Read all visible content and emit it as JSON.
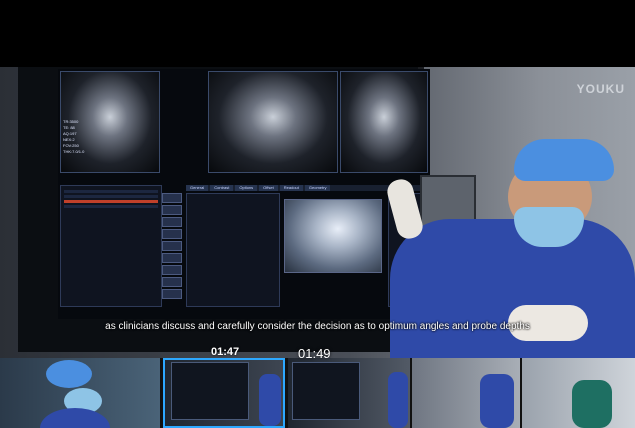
{
  "player": {
    "logo": "YOUKU",
    "caption": "as clinicians discuss and carefully consider the decision as to optimum angles and probe depths"
  },
  "screen": {
    "tabs": [
      "General",
      "Contrast",
      "Options",
      "Offset",
      "Readout",
      "Geometry"
    ],
    "buttons": [
      "",
      "",
      "",
      "",
      "",
      "",
      "",
      "",
      ""
    ],
    "scan_labels": [
      "TR:3500",
      "TE: 88",
      "AQ:197",
      "NEX:2",
      "FOV:250",
      "THK:7.0/1.0"
    ]
  },
  "preview": {
    "hover_time": "01:47",
    "current_time": "01:49"
  }
}
